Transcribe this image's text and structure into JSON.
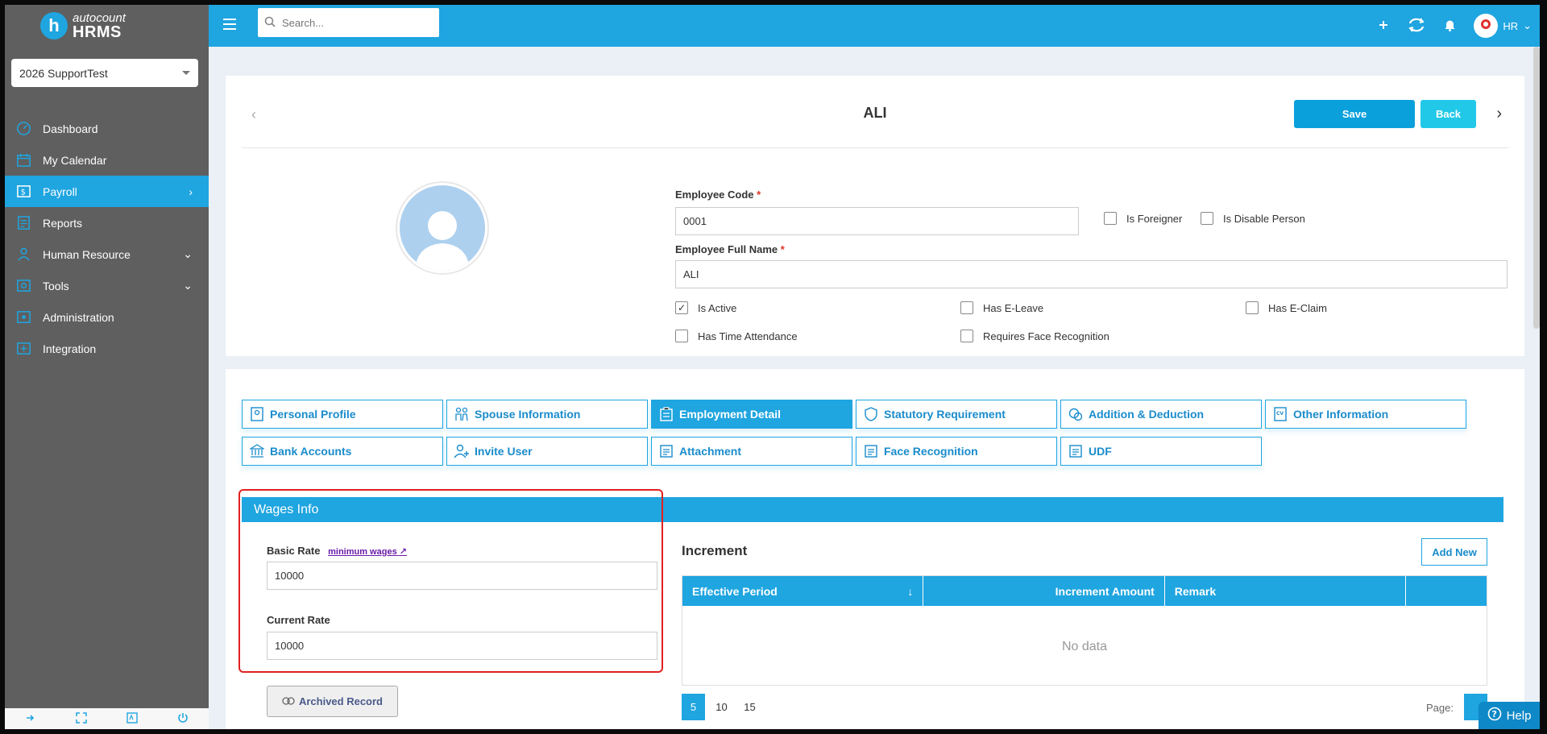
{
  "brand": {
    "line1": "autocount",
    "line2": "HRMS",
    "logo_letter": "h"
  },
  "company": {
    "selected": "2026 SupportTest"
  },
  "sidebar": {
    "items": [
      {
        "label": "Dashboard",
        "icon": "dashboard-icon"
      },
      {
        "label": "My Calendar",
        "icon": "calendar-icon"
      },
      {
        "label": "Payroll",
        "icon": "payroll-icon",
        "active": true
      },
      {
        "label": "Reports",
        "icon": "reports-icon"
      },
      {
        "label": "Human Resource",
        "icon": "human-resource-icon"
      },
      {
        "label": "Tools",
        "icon": "tools-icon"
      },
      {
        "label": "Administration",
        "icon": "administration-icon"
      },
      {
        "label": "Integration",
        "icon": "integration-icon"
      }
    ]
  },
  "topbar": {
    "search_placeholder": "Search...",
    "user_label": "HR"
  },
  "employee": {
    "name": "ALI",
    "save_label": "Save",
    "back_label": "Back",
    "code_label": "Employee Code",
    "code_value": "0001",
    "fullname_label": "Employee Full Name",
    "fullname_value": "ALI",
    "required_mark": "*",
    "checks": {
      "is_foreigner": "Is Foreigner",
      "is_disable_person": "Is Disable Person",
      "is_active": "Is Active",
      "has_eleave": "Has E-Leave",
      "has_eclaim": "Has E-Claim",
      "has_time_attendance": "Has Time Attendance",
      "requires_face_recognition": "Requires Face Recognition"
    }
  },
  "tabs": [
    "Personal Profile",
    "Spouse Information",
    "Employment Detail",
    "Statutory Requirement",
    "Addition & Deduction",
    "Other Information",
    "Bank Accounts",
    "Invite User",
    "Attachment",
    "Face Recognition",
    "UDF"
  ],
  "wages": {
    "section_title": "Wages Info",
    "basic_rate_label": "Basic Rate",
    "minimum_wages_link": "minimum wages",
    "basic_rate_value": "10000",
    "current_rate_label": "Current Rate",
    "current_rate_value": "10000",
    "archived_label": "Archived Record"
  },
  "increment": {
    "title": "Increment",
    "add_new_label": "Add New",
    "columns": [
      "Effective Period",
      "Increment Amount",
      "Remark",
      ""
    ],
    "empty_text": "No data",
    "page_sizes": [
      "5",
      "10",
      "15"
    ],
    "page_label": "Page:"
  },
  "help_label": "Help",
  "colors": {
    "accent": "#1fa5e0",
    "sidebar": "#5f5f5f",
    "highlight": "#e02020"
  }
}
